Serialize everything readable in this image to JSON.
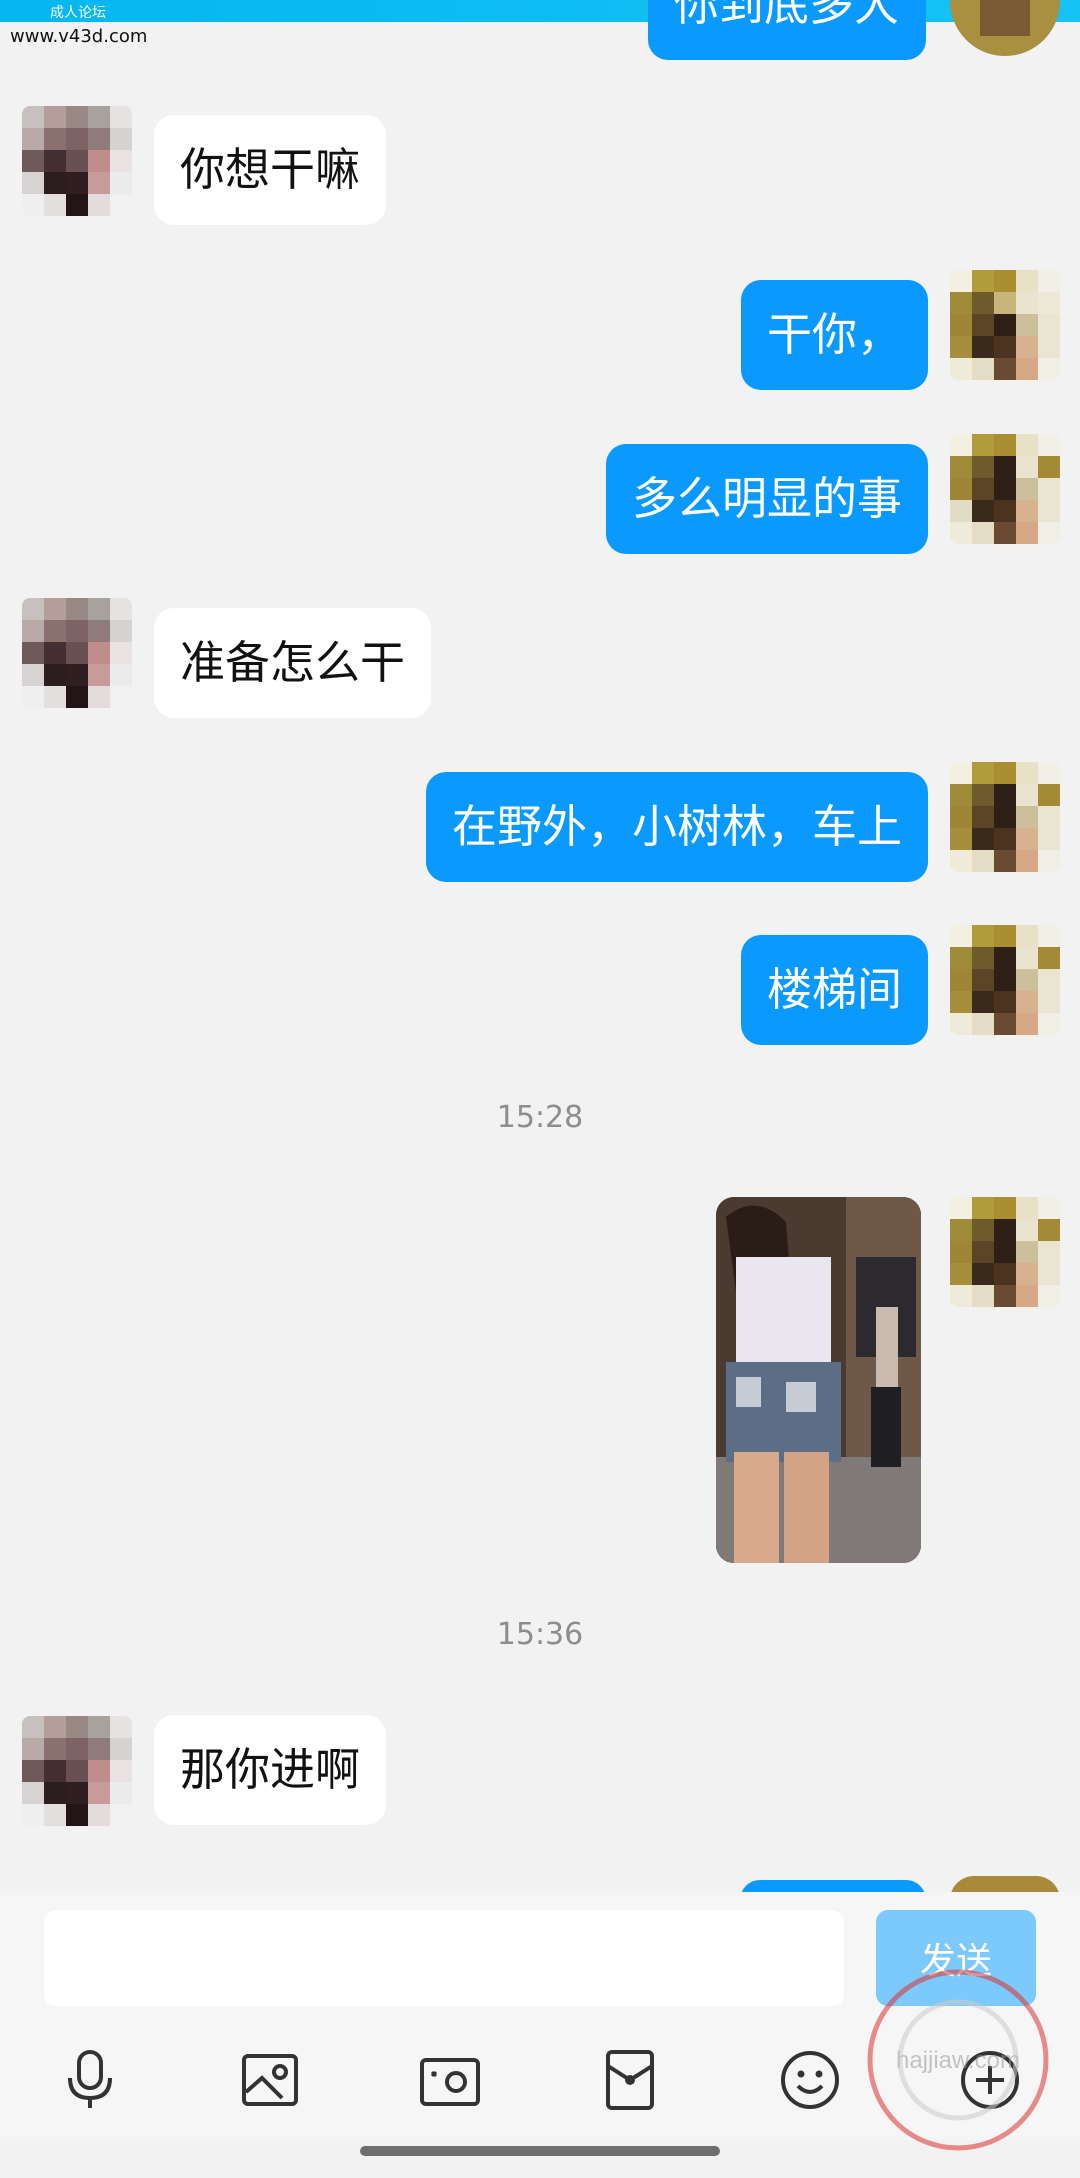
{
  "watermark": {
    "top_label": "成人论坛",
    "site": "www.v43d.com"
  },
  "conversation": {
    "top_partial_text": "你到底多大",
    "messages": [
      {
        "side": "in",
        "text": "你想干嘛"
      },
      {
        "side": "out",
        "text": "干你，"
      },
      {
        "side": "out",
        "text": "多么明显的事"
      },
      {
        "side": "in",
        "text": "准备怎么干"
      },
      {
        "side": "out",
        "text": "在野外，小树林，车上"
      },
      {
        "side": "out",
        "text": "楼梯间"
      }
    ],
    "time_1": "15:28",
    "time_2": "15:36",
    "after_image": {
      "side": "in",
      "text": "那你进啊"
    }
  },
  "input": {
    "value": "",
    "placeholder": "",
    "send_label": "发送"
  },
  "toolbar": {
    "icons": [
      "microphone-icon",
      "picture-icon",
      "camera-icon",
      "red-packet-icon",
      "emoji-icon",
      "plus-icon"
    ]
  },
  "colors": {
    "background": "#f2f2f2",
    "outgoing_bubble": "#0a99ff",
    "incoming_bubble": "#ffffff",
    "send_button": "#7cc9fb",
    "timestamp_text": "#8d8d8d"
  },
  "stamp_text": "hajjiaw.com"
}
